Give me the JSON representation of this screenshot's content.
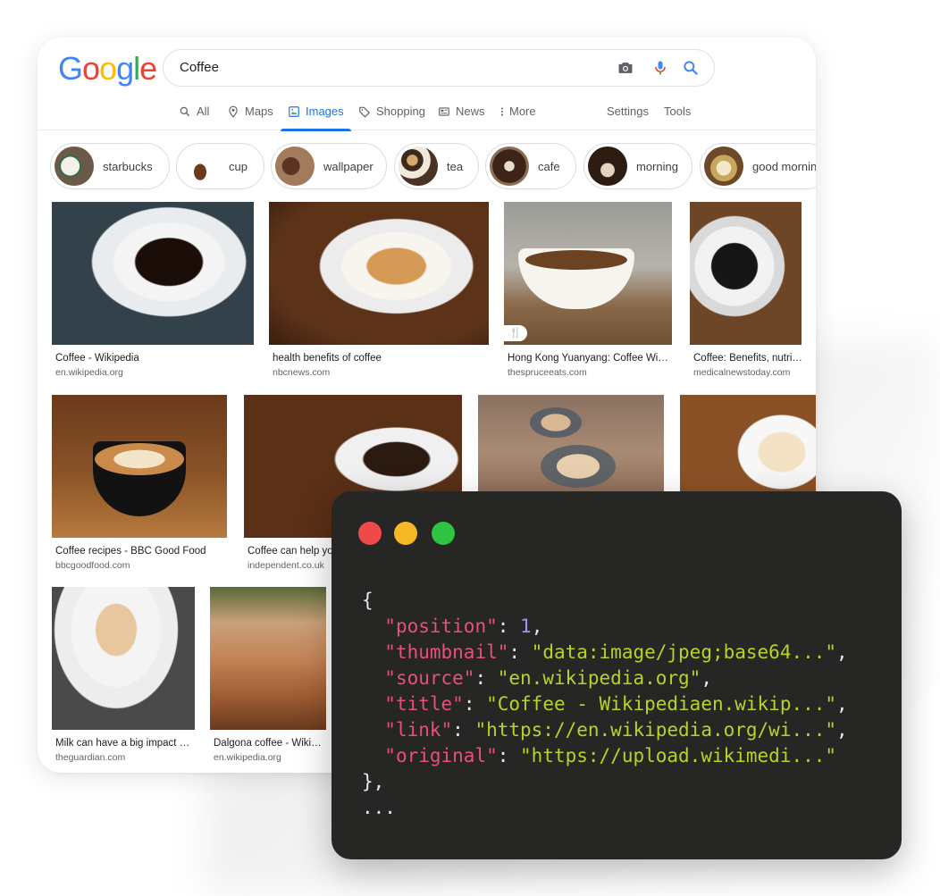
{
  "logo_letters": [
    "G",
    "o",
    "o",
    "g",
    "l",
    "e"
  ],
  "search": {
    "value": "Coffee"
  },
  "search_icons": [
    "camera-icon",
    "microphone-icon",
    "search-icon"
  ],
  "tabs": [
    {
      "label": "All",
      "icon": "search-icon",
      "active": false
    },
    {
      "label": "Maps",
      "icon": "map-pin-icon",
      "active": false
    },
    {
      "label": "Images",
      "icon": "image-icon",
      "active": true
    },
    {
      "label": "Shopping",
      "icon": "tag-icon",
      "active": false
    },
    {
      "label": "News",
      "icon": "newspaper-icon",
      "active": false
    },
    {
      "label": "More",
      "icon": "more-vert-icon",
      "active": false
    },
    {
      "label": "Settings",
      "active": false
    },
    {
      "label": "Tools",
      "active": false
    }
  ],
  "chips": [
    {
      "label": "starbucks"
    },
    {
      "label": "cup"
    },
    {
      "label": "wallpaper"
    },
    {
      "label": "tea"
    },
    {
      "label": "cafe"
    },
    {
      "label": "morning"
    },
    {
      "label": "good mornin"
    }
  ],
  "results": [
    {
      "title": "Coffee - Wikipedia",
      "source": "en.wikipedia.org"
    },
    {
      "title": "health benefits of coffee",
      "source": "nbcnews.com"
    },
    {
      "title": "Hong Kong Yuanyang: Coffee With ...",
      "source": "thespruceeats.com",
      "badge": "🍴"
    },
    {
      "title": "Coffee: Benefits, nutriti...",
      "source": "medicalnewstoday.com"
    },
    {
      "title": "Coffee recipes - BBC Good Food",
      "source": "bbcgoodfood.com"
    },
    {
      "title": "Coffee can help you",
      "source": "independent.co.uk"
    },
    {
      "title": "",
      "source": ""
    },
    {
      "title": "",
      "source": ""
    },
    {
      "title": "Milk can have a big impact o...",
      "source": "theguardian.com"
    },
    {
      "title": "Dalgona coffee - Wikip...",
      "source": "en.wikipedia.org"
    }
  ],
  "code": {
    "open_brace": "{",
    "lines": [
      {
        "key": "\"position\"",
        "value": "1",
        "type": "number"
      },
      {
        "key": "\"thumbnail\"",
        "value": "\"data:image/jpeg;base64...\"",
        "type": "string"
      },
      {
        "key": "\"source\"",
        "value": "\"en.wikipedia.org\"",
        "type": "string"
      },
      {
        "key": "\"title\"",
        "value": "\"Coffee - Wikipediaen.wikip...\"",
        "type": "string"
      },
      {
        "key": "\"link\"",
        "value": "\"https://en.wikipedia.org/wi...\"",
        "type": "string"
      },
      {
        "key": "\"original\"",
        "value": "\"https://upload.wikimedi...\"",
        "type": "string"
      }
    ],
    "close_brace": "},",
    "ellipsis": "..."
  },
  "window_dots": [
    {
      "name": "close-dot",
      "color": "#f0494a"
    },
    {
      "name": "minimize-dot",
      "color": "#f7b825"
    },
    {
      "name": "maximize-dot",
      "color": "#2ec340"
    }
  ],
  "colors": {
    "accent": "#1a73e8",
    "code_key": "#e8507a",
    "code_string": "#b5d42a",
    "code_number": "#a98cf5",
    "code_bg": "#262624"
  }
}
